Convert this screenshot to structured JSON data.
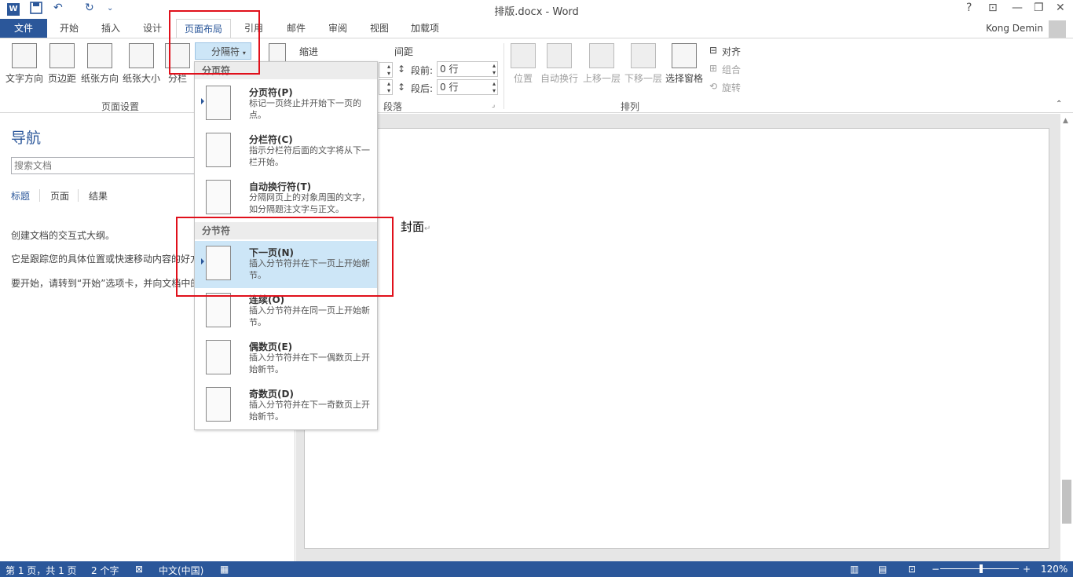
{
  "window": {
    "title": "排版.docx - Word",
    "help": "?",
    "restore_ribbon": "⊡",
    "minimize": "—",
    "maximize": "❐",
    "close": "✕"
  },
  "quick_access": {
    "save_icon": "save-icon",
    "undo": "↶",
    "redo": "↻",
    "customize": "⌄"
  },
  "tabs": {
    "file": "文件",
    "items": [
      "开始",
      "插入",
      "设计",
      "页面布局",
      "引用",
      "邮件",
      "审阅",
      "视图",
      "加载项"
    ],
    "active": "页面布局",
    "user": "Kong Demin"
  },
  "ribbon": {
    "page_setup": {
      "label": "页面设置",
      "buttons": [
        "文字方向",
        "页边距",
        "纸张方向",
        "纸张大小",
        "分栏"
      ]
    },
    "breaks_button": "分隔符",
    "indent_label": "缩进",
    "spacing": {
      "label": "间距",
      "before_label": "段前:",
      "before_value": "0 行",
      "after_label": "段后:",
      "after_value": "0 行"
    },
    "paragraph_label": "段落",
    "arrange": {
      "label": "排列",
      "buttons": [
        "位置",
        "自动换行",
        "上移一层",
        "下移一层",
        "选择窗格"
      ],
      "small": [
        "对齐",
        "组合",
        "旋转"
      ]
    }
  },
  "nav": {
    "title": "导航",
    "search_placeholder": "搜索文档",
    "tabs": [
      "标题",
      "页面",
      "结果"
    ],
    "messages": [
      "创建文档的交互式大纲。",
      "它是跟踪您的具体位置或快速移动内容的好方",
      "要开始，请转到“开始”选项卡，并向文档中的"
    ]
  },
  "document": {
    "text": "封面",
    "para_mark": "↵"
  },
  "dropdown": {
    "section1": "分页符",
    "page_breaks": [
      {
        "name": "分页符(P)",
        "desc": "标记一页终止并开始下一页的点。"
      },
      {
        "name": "分栏符(C)",
        "desc": "指示分栏符后面的文字将从下一栏开始。"
      },
      {
        "name": "自动换行符(T)",
        "desc": "分隔网页上的对象周围的文字，如分隔题注文字与正文。"
      }
    ],
    "section2": "分节符",
    "section_breaks": [
      {
        "name": "下一页(N)",
        "desc": "插入分节符并在下一页上开始新节。"
      },
      {
        "name": "连续(O)",
        "desc": "插入分节符并在同一页上开始新节。"
      },
      {
        "name": "偶数页(E)",
        "desc": "插入分节符并在下一偶数页上开始新节。"
      },
      {
        "name": "奇数页(D)",
        "desc": "插入分节符并在下一奇数页上开始新节。"
      }
    ]
  },
  "statusbar": {
    "page": "第 1 页，共 1 页",
    "words": "2 个字",
    "language": "中文(中国)",
    "zoom_minus": "−",
    "zoom_plus": "+",
    "zoom": "120%"
  },
  "colors": {
    "accent": "#2b579a",
    "highlight": "#cde6f7",
    "red_box": "#e0101b"
  }
}
